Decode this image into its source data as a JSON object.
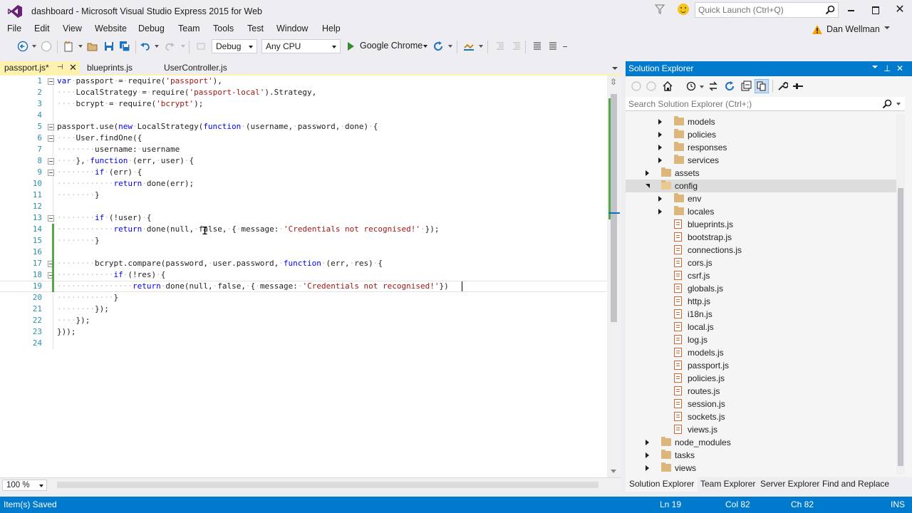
{
  "app": {
    "window_title": "dashboard - Microsoft Visual Studio Express 2015 for Web",
    "quick_launch_placeholder": "Quick Launch (Ctrl+Q)",
    "user_name": "Dan Wellman",
    "accent_color": "#007acc"
  },
  "menu": [
    "File",
    "Edit",
    "View",
    "Website",
    "Debug",
    "Team",
    "Tools",
    "Test",
    "Window",
    "Help"
  ],
  "toolbar": {
    "configuration": "Debug",
    "platform": "Any CPU",
    "run_target": "Google Chrome",
    "icons": [
      "back-icon",
      "forward-icon",
      "new-project-icon",
      "open-file-icon",
      "save-icon",
      "save-all-icon",
      "undo-icon",
      "redo-icon",
      "find-icon",
      "run-icon",
      "refresh-icon",
      "browser-link-icon",
      "comment-icon",
      "uncomment-icon"
    ]
  },
  "editor": {
    "tabs": [
      {
        "label": "passport.js*",
        "active": true,
        "pinned": true
      },
      {
        "label": "blueprints.js",
        "active": false
      },
      {
        "label": "UserController.js",
        "active": false
      }
    ],
    "zoom": "100 %",
    "current_line": 19,
    "lines": [
      {
        "n": "1",
        "text": "var passport = require('passport'),"
      },
      {
        "n": "2",
        "text": "    LocalStrategy = require('passport-local').Strategy,"
      },
      {
        "n": "3",
        "text": "    bcrypt = require('bcrypt');"
      },
      {
        "n": "4",
        "text": ""
      },
      {
        "n": "5",
        "text": "passport.use(new LocalStrategy(function (username, password, done) {"
      },
      {
        "n": "6",
        "text": "    User.findOne({"
      },
      {
        "n": "7",
        "text": "        username: username"
      },
      {
        "n": "8",
        "text": "    }, function (err, user) {"
      },
      {
        "n": "9",
        "text": "        if (err) {"
      },
      {
        "n": "10",
        "text": "            return done(err);"
      },
      {
        "n": "11",
        "text": "        }"
      },
      {
        "n": "12",
        "text": ""
      },
      {
        "n": "13",
        "text": "        if (!user) {"
      },
      {
        "n": "14",
        "text": "            return done(null, false, { message: 'Credentials not recognised!' });"
      },
      {
        "n": "15",
        "text": "        }"
      },
      {
        "n": "16",
        "text": ""
      },
      {
        "n": "17",
        "text": "        bcrypt.compare(password, user.password, function (err, res) {"
      },
      {
        "n": "18",
        "text": "            if (!res) {"
      },
      {
        "n": "19",
        "text": "                return done(null, false, { message: 'Credentials not recognised!'})"
      },
      {
        "n": "20",
        "text": "            }"
      },
      {
        "n": "21",
        "text": "        });"
      },
      {
        "n": "22",
        "text": "    });"
      },
      {
        "n": "23",
        "text": "}));"
      },
      {
        "n": "24",
        "text": ""
      }
    ]
  },
  "solution_explorer": {
    "title": "Solution Explorer",
    "search_placeholder": "Search Solution Explorer (Ctrl+;)",
    "tree": [
      {
        "label": "models",
        "type": "folder",
        "level": 2,
        "state": "collapsed"
      },
      {
        "label": "policies",
        "type": "folder",
        "level": 2,
        "state": "collapsed"
      },
      {
        "label": "responses",
        "type": "folder",
        "level": 2,
        "state": "collapsed"
      },
      {
        "label": "services",
        "type": "folder",
        "level": 2,
        "state": "collapsed"
      },
      {
        "label": "assets",
        "type": "folder",
        "level": 1,
        "state": "collapsed"
      },
      {
        "label": "config",
        "type": "folder",
        "level": 1,
        "state": "expanded",
        "selected": true
      },
      {
        "label": "env",
        "type": "folder",
        "level": 2,
        "state": "collapsed"
      },
      {
        "label": "locales",
        "type": "folder",
        "level": 2,
        "state": "collapsed"
      },
      {
        "label": "blueprints.js",
        "type": "file",
        "level": 2
      },
      {
        "label": "bootstrap.js",
        "type": "file",
        "level": 2
      },
      {
        "label": "connections.js",
        "type": "file",
        "level": 2
      },
      {
        "label": "cors.js",
        "type": "file",
        "level": 2
      },
      {
        "label": "csrf.js",
        "type": "file",
        "level": 2
      },
      {
        "label": "globals.js",
        "type": "file",
        "level": 2
      },
      {
        "label": "http.js",
        "type": "file",
        "level": 2
      },
      {
        "label": "i18n.js",
        "type": "file",
        "level": 2
      },
      {
        "label": "local.js",
        "type": "file",
        "level": 2
      },
      {
        "label": "log.js",
        "type": "file",
        "level": 2
      },
      {
        "label": "models.js",
        "type": "file",
        "level": 2
      },
      {
        "label": "passport.js",
        "type": "file",
        "level": 2
      },
      {
        "label": "policies.js",
        "type": "file",
        "level": 2
      },
      {
        "label": "routes.js",
        "type": "file",
        "level": 2
      },
      {
        "label": "session.js",
        "type": "file",
        "level": 2
      },
      {
        "label": "sockets.js",
        "type": "file",
        "level": 2
      },
      {
        "label": "views.js",
        "type": "file",
        "level": 2
      },
      {
        "label": "node_modules",
        "type": "folder",
        "level": 1,
        "state": "collapsed"
      },
      {
        "label": "tasks",
        "type": "folder",
        "level": 1,
        "state": "collapsed"
      },
      {
        "label": "views",
        "type": "folder",
        "level": 1,
        "state": "collapsed"
      }
    ],
    "bottom_tabs": [
      "Solution Explorer",
      "Team Explorer",
      "Server Explorer",
      "Find and Replace"
    ]
  },
  "status": {
    "message": "Item(s) Saved",
    "line": "Ln 19",
    "col": "Col 82",
    "ch": "Ch 82",
    "mode": "INS"
  }
}
